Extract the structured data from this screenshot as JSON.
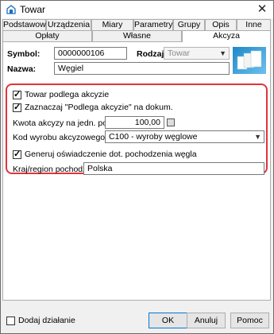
{
  "window": {
    "title": "Towar",
    "close_symbol": "✕"
  },
  "tabs_row1": [
    "Podstawowe",
    "Urządzenia",
    "Miary",
    "Parametry",
    "Grupy",
    "Opis",
    "Inne"
  ],
  "tabs_row2": [
    "Opłaty",
    "Własne",
    "Akcyza"
  ],
  "active_tab": "Akcyza",
  "header": {
    "symbol_label": "Symbol:",
    "symbol_value": "0000000106",
    "rodzaj_label": "Rodzaj:",
    "rodzaj_value": "Towar",
    "nazwa_label": "Nazwa:",
    "nazwa_value": "Węgiel"
  },
  "akcyza": {
    "towar_podlega_label": "Towar podlega akcyzie",
    "towar_podlega_checked": true,
    "zaznaczaj_label": "Zaznaczaj \"Podlega akcyzie\" na dokum.",
    "zaznaczaj_checked": true,
    "kwota_label": "Kwota akcyzy na jedn. podst.:",
    "kwota_value": "100,00",
    "kod_label": "Kod wyrobu akcyzowego:",
    "kod_value": "C100 - wyroby węglowe",
    "generuj_label": "Generuj oświadczenie dot. pochodzenia węgla",
    "generuj_checked": true,
    "kraj_label": "Kraj/region pochodzenia:",
    "kraj_value": "Polska"
  },
  "footer": {
    "dodaj_label": "Dodaj działanie",
    "dodaj_checked": false,
    "ok_label": "OK",
    "anuluj_label": "Anuluj",
    "pomoc_label": "Pomoc"
  },
  "colors": {
    "highlight_border": "#e0343c",
    "logo": "#1e88c8"
  },
  "icons": [
    "app-icon",
    "close-icon",
    "checkbox-icon",
    "calculator-icon",
    "dropdown-arrow-icon",
    "product-logo-icon"
  ]
}
